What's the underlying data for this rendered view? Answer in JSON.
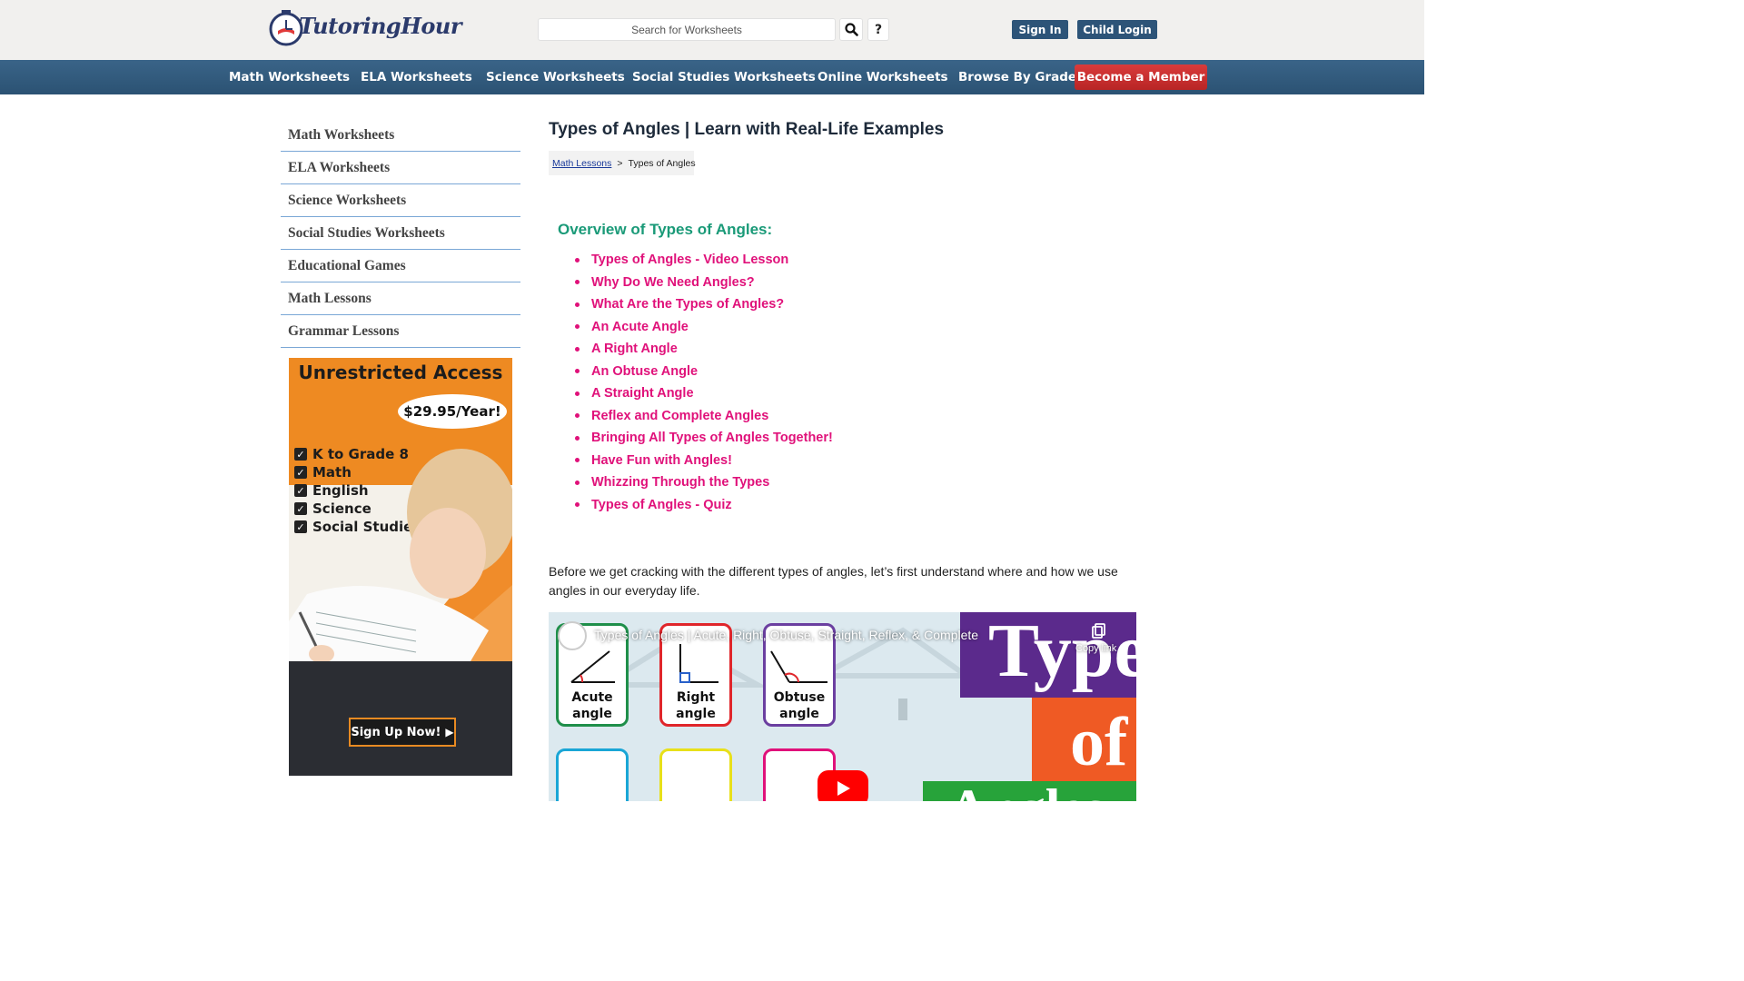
{
  "header": {
    "logo": {
      "text_part1": "Tutoring",
      "text_part2": "Hour"
    },
    "search": {
      "placeholder": "Search for Worksheets"
    },
    "help_label": "?",
    "sign_in_label": "Sign In",
    "child_login_label": "Child Login"
  },
  "nav": {
    "items": [
      {
        "label": "Math Worksheets"
      },
      {
        "label": "ELA Worksheets"
      },
      {
        "label": "Science Worksheets"
      },
      {
        "label": "Social Studies Worksheets"
      },
      {
        "label": "Online Worksheets"
      },
      {
        "label": "Browse By Grade"
      }
    ],
    "member_label": "Become a Member"
  },
  "sidebar": {
    "items": [
      {
        "label": "Math Worksheets"
      },
      {
        "label": "ELA Worksheets"
      },
      {
        "label": "Science Worksheets"
      },
      {
        "label": "Social Studies Worksheets"
      },
      {
        "label": "Educational Games"
      },
      {
        "label": "Math Lessons"
      },
      {
        "label": "Grammar Lessons"
      }
    ],
    "ad": {
      "title": "Unrestricted Access",
      "price": "$29.95/Year!",
      "features": [
        "K to Grade 8",
        "Math",
        "English",
        "Science",
        "Social Studies"
      ],
      "cta": "Sign Up Now!"
    }
  },
  "main": {
    "title": "Types of Angles | Learn with Real-Life Examples",
    "breadcrumb": {
      "parent": "Math Lessons",
      "separator": ">",
      "current": "Types of Angles"
    },
    "overview_title": "Overview of Types of Angles:",
    "toc": [
      "Types of Angles - Video Lesson",
      "Why Do We Need Angles?",
      "What Are the Types of Angles?",
      "An Acute Angle",
      "A Right Angle",
      "An Obtuse Angle",
      "A Straight Angle",
      "Reflex and Complete Angles",
      "Bringing All Types of Angles Together!",
      "Have Fun with Angles!",
      "Whizzing Through the Types",
      "Types of Angles - Quiz"
    ],
    "intro": "Before we get cracking with the different types of angles, let’s first understand where and how we use angles in our everyday life.",
    "video": {
      "title": "Types of Angles | Acute, Right, Obtuse, Straight, Reflex, & Complete",
      "copy_label": "Copy link",
      "cards": [
        {
          "line1": "Acute",
          "line2": "angle",
          "color": "#1f8f4a"
        },
        {
          "line1": "Right",
          "line2": "angle",
          "color": "#e0262b"
        },
        {
          "line1": "Obtuse",
          "line2": "angle",
          "color": "#6b3fa0"
        }
      ],
      "big_text_1": "Types",
      "big_text_2": "of",
      "big_text_3": "Angles"
    }
  },
  "colors": {
    "nav_bg": "#2d5478",
    "member_bg": "#cc2f2f",
    "toc_link": "#e0117a",
    "overview_heading": "#1a9a78"
  }
}
